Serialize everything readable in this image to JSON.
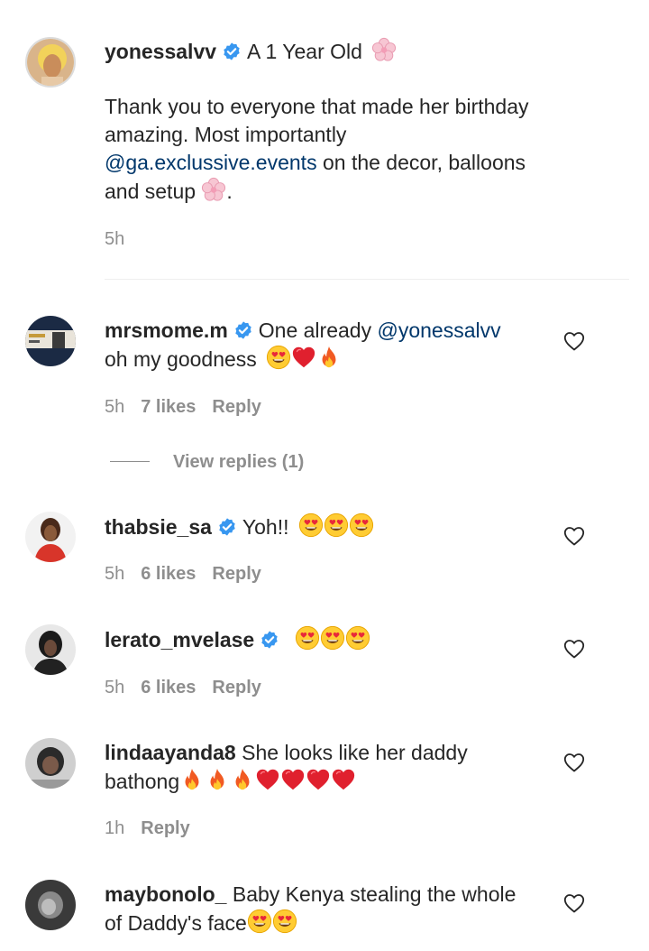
{
  "caption": {
    "username": "yonessalvv",
    "title": "A 1 Year Old",
    "line1": "Thank you to everyone that made her birthday",
    "line2": "amazing. Most importantly",
    "mention": "@ga.exclussive.events",
    "line3_rest": " on the decor, balloons",
    "line4": "and setup",
    "line4_end": ".",
    "time": "5h"
  },
  "comments": [
    {
      "username": "mrsmome.m",
      "text": "One already ",
      "mention": "@yonessalvv",
      "text2": "oh my goodness",
      "time": "5h",
      "likes": "7 likes",
      "reply": "Reply",
      "view_replies": "View replies (1)"
    },
    {
      "username": "thabsie_sa",
      "text": "Yoh!!",
      "time": "5h",
      "likes": "6 likes",
      "reply": "Reply"
    },
    {
      "username": "lerato_mvelase",
      "text": "",
      "time": "5h",
      "likes": "6 likes",
      "reply": "Reply"
    },
    {
      "username": "lindaayanda8",
      "text": "She looks like her daddy",
      "text2": "bathong",
      "time": "1h",
      "reply": "Reply"
    },
    {
      "username": "maybonolo_",
      "text": "Baby Kenya stealing the whole",
      "text2": "of Daddy's face"
    }
  ],
  "colors": {
    "verified": "#3897f0",
    "mention": "#00376b",
    "muted": "#8e8e8e"
  }
}
